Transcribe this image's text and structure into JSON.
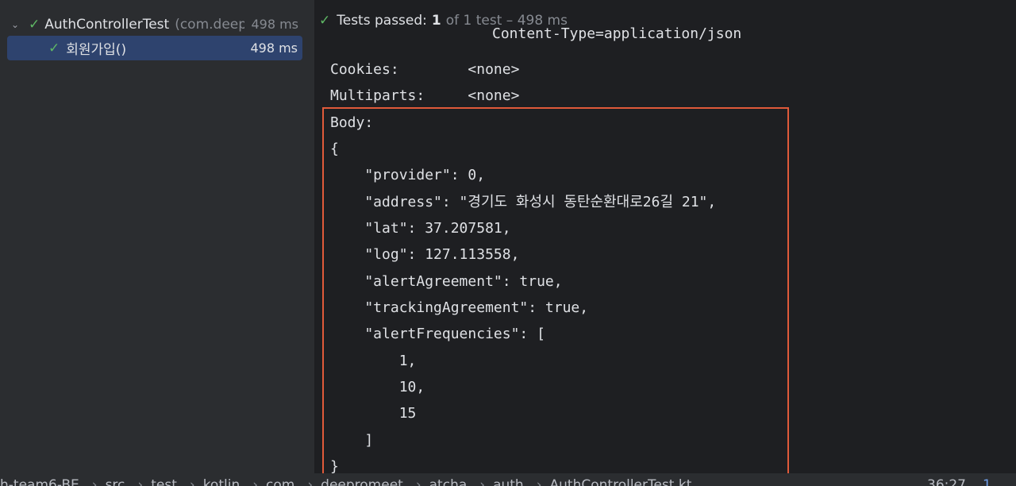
{
  "tree": {
    "root": {
      "name": "AuthControllerTest",
      "package": "(com.deep",
      "duration": "498 ms"
    },
    "child": {
      "name": "회원가입()",
      "duration": "498 ms"
    }
  },
  "status": {
    "label": "Tests passed:",
    "count": "1",
    "rest": "of 1 test – 498 ms"
  },
  "console": {
    "cut_line": "Content-Type=application/json",
    "lines": [
      "Cookies:        <none>",
      "Multiparts:     <none>",
      "Body:",
      "{",
      "    \"provider\": 0,",
      "    \"address\": \"경기도 화성시 동탄순환대로26길 21\",",
      "    \"lat\": 37.207581,",
      "    \"log\": 127.113558,",
      "    \"alertAgreement\": true,",
      "    \"trackingAgreement\": true,",
      "    \"alertFrequencies\": [",
      "        1,",
      "        10,",
      "        15",
      "    ]",
      "}"
    ]
  },
  "breadcrumb": {
    "items": [
      "h-team6-BE",
      "src",
      "test",
      "kotlin",
      "com",
      "deepromeet",
      "atcha",
      "auth",
      "AuthControllerTest.kt"
    ],
    "cursor": "36:27",
    "notification": "1"
  },
  "colors": {
    "accent_pass": "#5fb865",
    "highlight_box": "#e05a3a",
    "selection": "#2e436e"
  }
}
